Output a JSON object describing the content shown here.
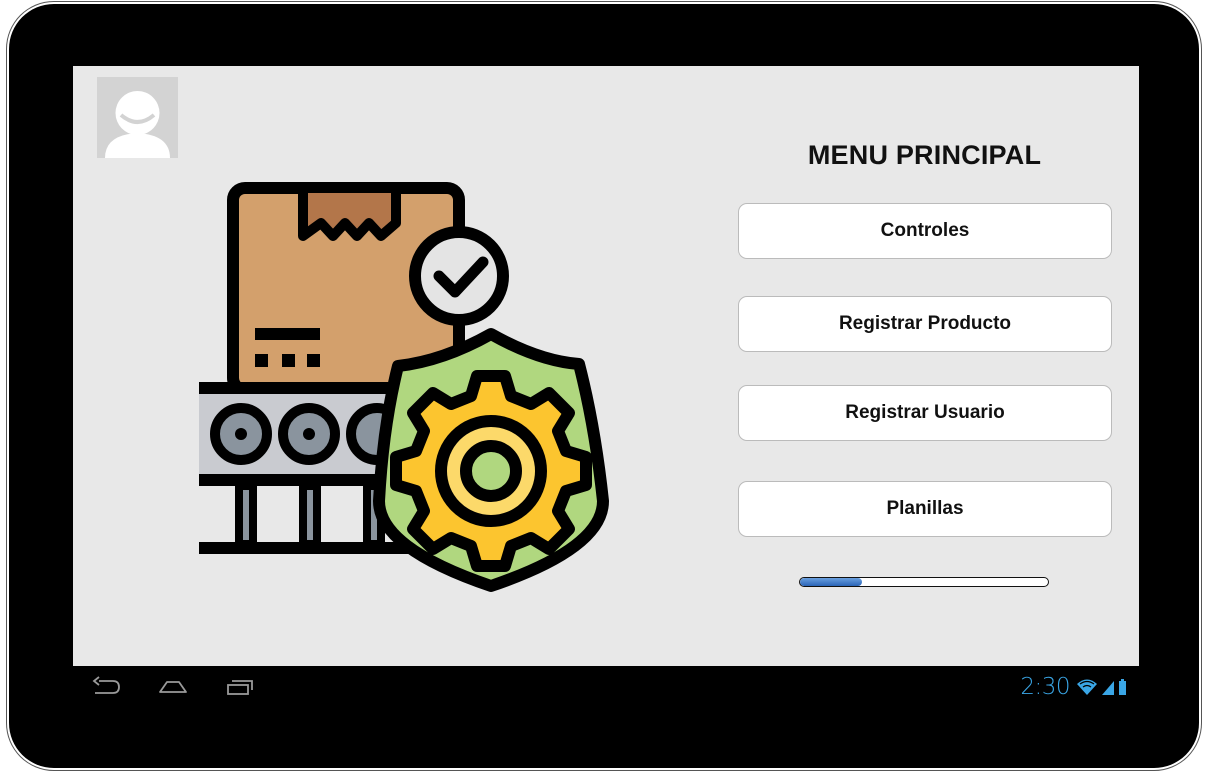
{
  "screen": {
    "title": "MENU PRINCIPAL",
    "buttons": [
      {
        "label": "Controles"
      },
      {
        "label": "Registrar Producto"
      },
      {
        "label": "Registrar Usuario"
      },
      {
        "label": "Planillas"
      }
    ],
    "progress": {
      "value_percent": 25
    }
  },
  "navbar": {
    "icons": [
      "back-icon",
      "home-icon",
      "recent-apps-icon"
    ]
  },
  "status_bar": {
    "time": "2:30",
    "icons": [
      "wifi-icon",
      "signal-icon",
      "battery-icon"
    ]
  },
  "colors": {
    "screen_bg": "#e8e8e8",
    "accent": "#3aa6e6",
    "progress_fill": "#2a64b8",
    "box": "#d3a06c",
    "shield": "#b0d77f",
    "gear": "#fcc52f"
  }
}
